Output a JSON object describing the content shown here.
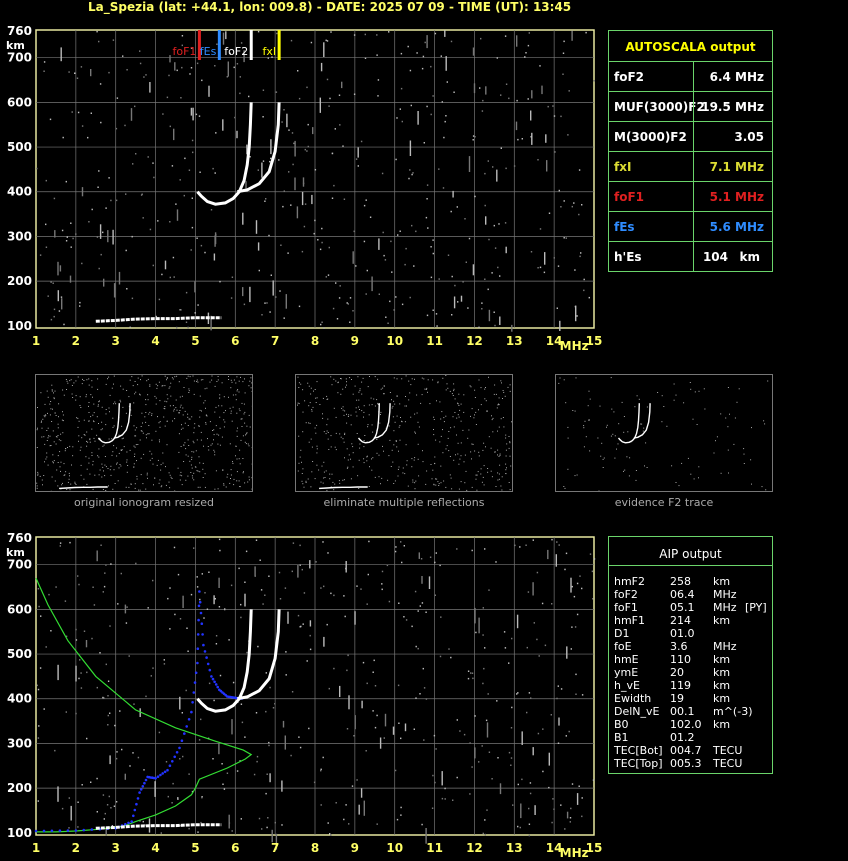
{
  "header": {
    "title": "La_Spezia (lat: +44.1, lon: 009.8) - DATE: 2025 07 09 - TIME (UT): 13:45"
  },
  "chart_data": [
    {
      "type": "scatter",
      "title": "",
      "xlabel": "MHz",
      "ylabel": "km",
      "xlim": [
        1,
        15
      ],
      "ylim": [
        95,
        762
      ],
      "x_ticks": [
        "1",
        "2",
        "3",
        "4",
        "5",
        "6",
        "7",
        "8",
        "9",
        "10",
        "11",
        "12",
        "13",
        "14",
        "15"
      ],
      "y_ticks": [
        "100",
        "200",
        "300",
        "400",
        "500",
        "600",
        "700",
        "760"
      ],
      "grid": true,
      "markers": [
        {
          "label": "foF1",
          "freq": 5.1,
          "color": "#e02020"
        },
        {
          "label": "fEs",
          "freq": 5.6,
          "color": "#2f8cff"
        },
        {
          "label": "foF2",
          "freq": 6.4,
          "color": "#ffffff"
        },
        {
          "label": "fxI",
          "freq": 7.1,
          "color": "#ffff00"
        }
      ],
      "series": [
        {
          "name": "O-trace",
          "color": "#ffffff",
          "x": [
            5.05,
            5.15,
            5.3,
            5.5,
            5.75,
            5.95,
            6.1,
            6.22,
            6.3,
            6.35,
            6.38,
            6.4
          ],
          "y": [
            400,
            390,
            378,
            372,
            375,
            385,
            400,
            425,
            460,
            500,
            550,
            600
          ]
        },
        {
          "name": "X-trace",
          "color": "#ffffff",
          "x": [
            6.05,
            6.3,
            6.6,
            6.85,
            7.0,
            7.08,
            7.1
          ],
          "y": [
            400,
            404,
            418,
            445,
            490,
            550,
            600
          ]
        },
        {
          "name": "Es-trace",
          "color": "#ffffff",
          "x": [
            2.5,
            3.0,
            3.5,
            4.0,
            4.5,
            5.0,
            5.5,
            5.65
          ],
          "y": [
            110,
            112,
            115,
            116,
            116,
            118,
            118,
            118
          ]
        }
      ]
    },
    {
      "type": "line",
      "title": "",
      "xlabel": "MHz",
      "ylabel": "km",
      "xlim": [
        1,
        15
      ],
      "ylim": [
        95,
        762
      ],
      "x_ticks": [
        "1",
        "2",
        "3",
        "4",
        "5",
        "6",
        "7",
        "8",
        "9",
        "10",
        "11",
        "12",
        "13",
        "14",
        "15"
      ],
      "y_ticks": [
        "100",
        "200",
        "300",
        "400",
        "500",
        "600",
        "700",
        "760"
      ],
      "grid": true,
      "series": [
        {
          "name": "profile",
          "color": "#33dd33",
          "x": [
            1.0,
            1.5,
            2.0,
            2.6,
            3.2,
            3.5,
            4.0,
            4.5,
            4.9,
            5.0,
            5.1,
            5.8,
            6.25,
            6.4,
            6.2,
            5.5,
            4.5,
            3.5,
            2.5,
            1.8,
            1.3,
            1.0
          ],
          "y": [
            102,
            102,
            104,
            108,
            115,
            125,
            140,
            160,
            185,
            200,
            220,
            245,
            265,
            275,
            285,
            305,
            335,
            375,
            450,
            530,
            610,
            670
          ]
        },
        {
          "name": "synthetic-O",
          "color": "#2233ff",
          "x": [
            1.0,
            2.0,
            3.0,
            3.4,
            3.6,
            3.8,
            4.0,
            4.3,
            4.6,
            4.9,
            5.05,
            5.1,
            5.2,
            5.4,
            5.6,
            5.8,
            6.0,
            6.2
          ],
          "y": [
            104,
            105,
            110,
            125,
            190,
            225,
            222,
            240,
            290,
            370,
            480,
            640,
            520,
            450,
            420,
            405,
            402,
            400
          ]
        },
        {
          "name": "O-trace",
          "color": "#ffffff",
          "x": [
            5.05,
            5.15,
            5.3,
            5.5,
            5.75,
            5.95,
            6.1,
            6.22,
            6.3,
            6.35,
            6.38,
            6.4
          ],
          "y": [
            400,
            390,
            378,
            372,
            375,
            385,
            400,
            425,
            460,
            500,
            550,
            600
          ]
        },
        {
          "name": "X-trace",
          "color": "#ffffff",
          "x": [
            6.05,
            6.3,
            6.6,
            6.85,
            7.0,
            7.08,
            7.1
          ],
          "y": [
            400,
            404,
            418,
            445,
            490,
            550,
            600
          ]
        },
        {
          "name": "Es-trace",
          "color": "#ffffff",
          "x": [
            2.5,
            3.0,
            3.5,
            4.0,
            4.5,
            5.0,
            5.5,
            5.65
          ],
          "y": [
            110,
            112,
            115,
            116,
            116,
            118,
            118,
            118
          ]
        }
      ]
    }
  ],
  "autoscala": {
    "title": "AUTOSCALA output",
    "rows": [
      {
        "label": "foF2",
        "value": "6.4 MHz",
        "color": "#ffffff"
      },
      {
        "label": "MUF(3000)F2",
        "value": "19.5 MHz",
        "color": "#ffffff"
      },
      {
        "label": "M(3000)F2",
        "value": "3.05",
        "color": "#ffffff"
      },
      {
        "label": "fxI",
        "value": "7.1 MHz",
        "color": "#dddd33"
      },
      {
        "label": "foF1",
        "value": "5.1 MHz",
        "color": "#e02020"
      },
      {
        "label": "fEs",
        "value": "5.6 MHz",
        "color": "#2f8cff"
      },
      {
        "label": "h'Es",
        "value": "104",
        "unit": "km",
        "color": "#ffffff"
      }
    ]
  },
  "thumbnails": {
    "captions": [
      "original ionogram resized",
      "eliminate multiple reflections",
      "evidence F2 trace"
    ]
  },
  "aip": {
    "title": "AIP output",
    "rows": [
      {
        "name": "hmF2",
        "value": "258",
        "unit": "km",
        "extra": ""
      },
      {
        "name": "foF2",
        "value": "06.4",
        "unit": "MHz",
        "extra": ""
      },
      {
        "name": "foF1",
        "value": "05.1",
        "unit": "MHz",
        "extra": "[PY]"
      },
      {
        "name": "hmF1",
        "value": "214",
        "unit": "km",
        "extra": ""
      },
      {
        "name": "D1",
        "value": "01.0",
        "unit": "",
        "extra": ""
      },
      {
        "name": "foE",
        "value": "3.6",
        "unit": "MHz",
        "extra": ""
      },
      {
        "name": "hmE",
        "value": "110",
        "unit": "km",
        "extra": ""
      },
      {
        "name": "ymE",
        "value": "20",
        "unit": "km",
        "extra": ""
      },
      {
        "name": "h_vE",
        "value": "119",
        "unit": "km",
        "extra": ""
      },
      {
        "name": "Ewidth",
        "value": "19",
        "unit": "km",
        "extra": ""
      },
      {
        "name": "DelN_vE",
        "value": "00.1",
        "unit": "m^(-3)",
        "extra": ""
      },
      {
        "name": "B0",
        "value": "102.0",
        "unit": "km",
        "extra": ""
      },
      {
        "name": "B1",
        "value": "01.2",
        "unit": "",
        "extra": ""
      },
      {
        "name": "TEC[Bot]",
        "value": "004.7",
        "unit": "TECU",
        "extra": ""
      },
      {
        "name": "TEC[Top]",
        "value": "005.3",
        "unit": "TECU",
        "extra": ""
      }
    ]
  }
}
